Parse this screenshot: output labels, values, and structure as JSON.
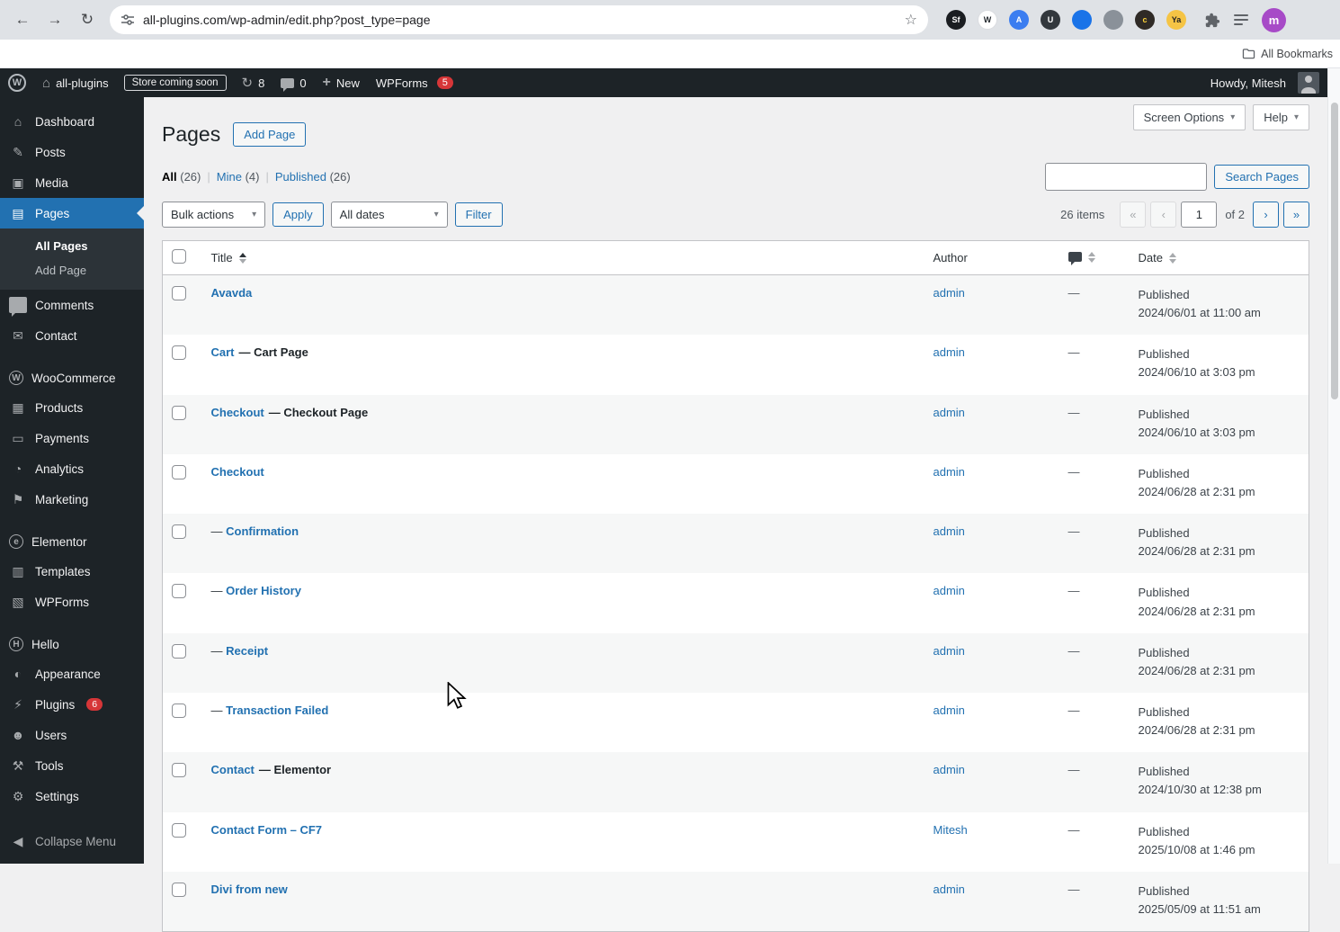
{
  "browser": {
    "url": "all-plugins.com/wp-admin/edit.php?post_type=page",
    "bookmarks_label": "All Bookmarks",
    "profile_initial": "m",
    "extensions": [
      {
        "label": "Sf",
        "bg": "#1a1d21",
        "fg": "#ffffff"
      },
      {
        "label": "W",
        "bg": "#ffffff",
        "fg": "#23282d",
        "border": "#dadce0"
      },
      {
        "label": "A",
        "bg": "#3b7df0",
        "fg": "#ffffff"
      },
      {
        "label": "U",
        "bg": "#33383d",
        "fg": "#ffffff"
      },
      {
        "label": "",
        "bg": "#1a73e8",
        "fg": "#ffffff"
      },
      {
        "label": "",
        "bg": "#8a9199",
        "fg": "#ffffff"
      },
      {
        "label": "c",
        "bg": "#2f2a26",
        "fg": "#ffd338"
      },
      {
        "label": "Ya",
        "bg": "#f5c445",
        "fg": "#222222"
      }
    ]
  },
  "admin_bar": {
    "site_name": "all-plugins",
    "store_badge": "Store coming soon",
    "updates": "8",
    "comments": "0",
    "new_label": "New",
    "wpforms": "WPForms",
    "wpforms_badge": "5",
    "howdy": "Howdy, Mitesh"
  },
  "sidebar": {
    "groups": [
      {
        "items": [
          {
            "label": "Dashboard",
            "icon": "dashboard-icon"
          },
          {
            "label": "Posts",
            "icon": "posts-icon"
          },
          {
            "label": "Media",
            "icon": "media-icon"
          },
          {
            "label": "Pages",
            "icon": "pages-icon",
            "active": true,
            "submenu": [
              {
                "label": "All Pages",
                "current": true
              },
              {
                "label": "Add Page"
              }
            ]
          },
          {
            "label": "Comments",
            "icon": "comments-icon"
          },
          {
            "label": "Contact",
            "icon": "contact-icon"
          }
        ]
      },
      {
        "items": [
          {
            "label": "WooCommerce",
            "icon": "woocommerce-icon"
          },
          {
            "label": "Products",
            "icon": "products-icon"
          },
          {
            "label": "Payments",
            "icon": "payments-icon"
          },
          {
            "label": "Analytics",
            "icon": "analytics-icon"
          },
          {
            "label": "Marketing",
            "icon": "marketing-icon"
          }
        ]
      },
      {
        "items": [
          {
            "label": "Elementor",
            "icon": "elementor-icon"
          },
          {
            "label": "Templates",
            "icon": "templates-icon"
          },
          {
            "label": "WPForms",
            "icon": "wpforms-icon"
          }
        ]
      },
      {
        "items": [
          {
            "label": "Hello",
            "icon": "hello-icon"
          },
          {
            "label": "Appearance",
            "icon": "appearance-icon"
          },
          {
            "label": "Plugins",
            "icon": "plugins-icon",
            "badge": "6"
          },
          {
            "label": "Users",
            "icon": "users-icon"
          },
          {
            "label": "Tools",
            "icon": "tools-icon"
          },
          {
            "label": "Settings",
            "icon": "settings-icon"
          }
        ]
      }
    ],
    "collapse_label": "Collapse Menu"
  },
  "page": {
    "title": "Pages",
    "add_page": "Add Page",
    "screen_options": "Screen Options",
    "help": "Help",
    "filters": [
      {
        "label": "All",
        "count": "(26)"
      },
      {
        "label": "Mine",
        "count": "(4)"
      },
      {
        "label": "Published",
        "count": "(26)"
      }
    ],
    "search_button": "Search Pages",
    "bulk_actions": "Bulk actions",
    "apply": "Apply",
    "all_dates": "All dates",
    "filter": "Filter",
    "pagination": {
      "items": "26 items",
      "first": "«",
      "prev": "‹",
      "current": "1",
      "of": "of 2",
      "next": "›",
      "last": "»"
    }
  },
  "table": {
    "headers": {
      "title": "Title",
      "author": "Author",
      "date": "Date"
    },
    "rows": [
      {
        "prefix": "",
        "title": "Avavda",
        "state": "",
        "author": "admin",
        "comments": "—",
        "status": "Published",
        "date": "2024/06/01 at 11:00 am"
      },
      {
        "prefix": "",
        "title": "Cart",
        "state": "— Cart Page",
        "author": "admin",
        "comments": "—",
        "status": "Published",
        "date": "2024/06/10 at 3:03 pm"
      },
      {
        "prefix": "",
        "title": "Checkout",
        "state": "— Checkout Page",
        "author": "admin",
        "comments": "—",
        "status": "Published",
        "date": "2024/06/10 at 3:03 pm"
      },
      {
        "prefix": "",
        "title": "Checkout",
        "state": "",
        "author": "admin",
        "comments": "—",
        "status": "Published",
        "date": "2024/06/28 at 2:31 pm"
      },
      {
        "prefix": "— ",
        "title": "Confirmation",
        "state": "",
        "author": "admin",
        "comments": "—",
        "status": "Published",
        "date": "2024/06/28 at 2:31 pm"
      },
      {
        "prefix": "— ",
        "title": "Order History",
        "state": "",
        "author": "admin",
        "comments": "—",
        "status": "Published",
        "date": "2024/06/28 at 2:31 pm"
      },
      {
        "prefix": "— ",
        "title": "Receipt",
        "state": "",
        "author": "admin",
        "comments": "—",
        "status": "Published",
        "date": "2024/06/28 at 2:31 pm"
      },
      {
        "prefix": "— ",
        "title": "Transaction Failed",
        "state": "",
        "author": "admin",
        "comments": "—",
        "status": "Published",
        "date": "2024/06/28 at 2:31 pm"
      },
      {
        "prefix": "",
        "title": "Contact",
        "state": "— Elementor",
        "author": "admin",
        "comments": "—",
        "status": "Published",
        "date": "2024/10/30 at 12:38 pm"
      },
      {
        "prefix": "",
        "title": "Contact Form – CF7",
        "state": "",
        "author": "Mitesh",
        "comments": "—",
        "status": "Published",
        "date": "2025/10/08 at 1:46 pm"
      },
      {
        "prefix": "",
        "title": "Divi from new",
        "state": "",
        "author": "admin",
        "comments": "—",
        "status": "Published",
        "date": "2025/05/09 at 11:51 am"
      }
    ]
  }
}
